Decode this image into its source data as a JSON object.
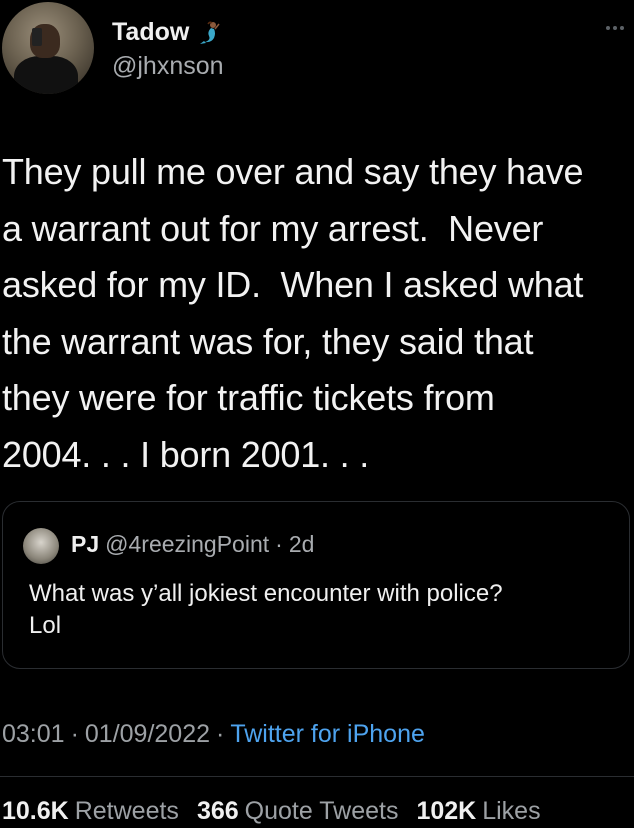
{
  "user": {
    "display_name": "Tadow",
    "name_emoji_icon": "mermaid-emoji-icon",
    "handle": "@jhxnson"
  },
  "tweet": {
    "text": "They pull me over and say they have\na warrant out for my arrest.  Never\nasked for my ID.  When I asked what\nthe warrant was for, they said that\nthey were for traffic tickets from\n2004. . . I born 2001. . ."
  },
  "quoted": {
    "name": "PJ",
    "handle": "@4reezingPoint",
    "separator": "·",
    "age": "2d",
    "text": "What was y’all jokiest encounter with police?\nLol"
  },
  "meta": {
    "time": "03:01",
    "sep1": "·",
    "date": "01/09/2022",
    "sep2": "·",
    "source": "Twitter for iPhone"
  },
  "stats": {
    "retweets_count": "10.6K",
    "retweets_label": "Retweets",
    "quotes_count": "366",
    "quotes_label": "Quote Tweets",
    "likes_count": "102K",
    "likes_label": "Likes"
  },
  "colors": {
    "background": "#000000",
    "text": "#f0f0f0",
    "secondary": "#9da1a5",
    "link": "#4ea3ee",
    "border": "#2a2d31"
  }
}
